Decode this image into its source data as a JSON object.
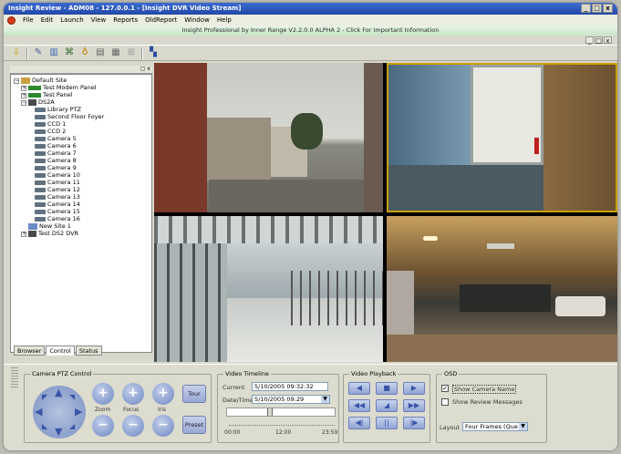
{
  "window": {
    "title": "Insight Review - ADM08 - 127.0.0.1 - [Insight DVR Video Stream]",
    "min": "_",
    "max": "□",
    "close": "x"
  },
  "menu": [
    "File",
    "Edit",
    "Launch",
    "View",
    "Reports",
    "OldReport",
    "Window",
    "Help"
  ],
  "info_banner": "Insight Professional by Inner Range V2.2.0.0 ALPHA 2 - Click For Important Information",
  "mdi": {
    "min": "_",
    "max": "□",
    "close": "x"
  },
  "tree": {
    "root": "Default Site",
    "items": [
      {
        "label": "Test Modem Panel"
      },
      {
        "label": "Test Panel"
      },
      {
        "label": "DS2A"
      },
      {
        "label": "Library PTZ"
      },
      {
        "label": "Second Floor Foyer"
      },
      {
        "label": "CCD 1"
      },
      {
        "label": "CCD 2"
      },
      {
        "label": "Camera 5"
      },
      {
        "label": "Camera 6"
      },
      {
        "label": "Camera 7"
      },
      {
        "label": "Camera 8"
      },
      {
        "label": "Camera 9"
      },
      {
        "label": "Camera 10"
      },
      {
        "label": "Camera 11"
      },
      {
        "label": "Camera 12"
      },
      {
        "label": "Camera 13"
      },
      {
        "label": "Camera 14"
      },
      {
        "label": "Camera 15"
      },
      {
        "label": "Camera 16"
      },
      {
        "label": "New Site 1"
      },
      {
        "label": "Test DS2 DVR"
      }
    ]
  },
  "tabs": [
    "Browser",
    "Control",
    "Status"
  ],
  "ptz": {
    "legend": "Camera PTZ Control",
    "zoom": "Zoom",
    "focus": "Focus",
    "iris": "Iris",
    "tour": "Tour",
    "preset": "Preset",
    "plus": "+",
    "minus": "−"
  },
  "timeline": {
    "legend": "Video Timeline",
    "current_label": "Current",
    "current_value": "5/10/2005 09:32:32",
    "datetime_label": "Date/Time",
    "datetime_value": "5/10/2005 09:29",
    "ticks": [
      "00:00",
      "12:00",
      "23:59"
    ]
  },
  "playback": {
    "legend": "Video Playback"
  },
  "osd": {
    "legend": "OSD",
    "show_camera_name": "Show Camera Name",
    "show_camera_name_checked": "✓",
    "show_review_messages": "Show Review Messages",
    "layout_label": "Layout",
    "layout_value": "Four Frames (Que"
  }
}
